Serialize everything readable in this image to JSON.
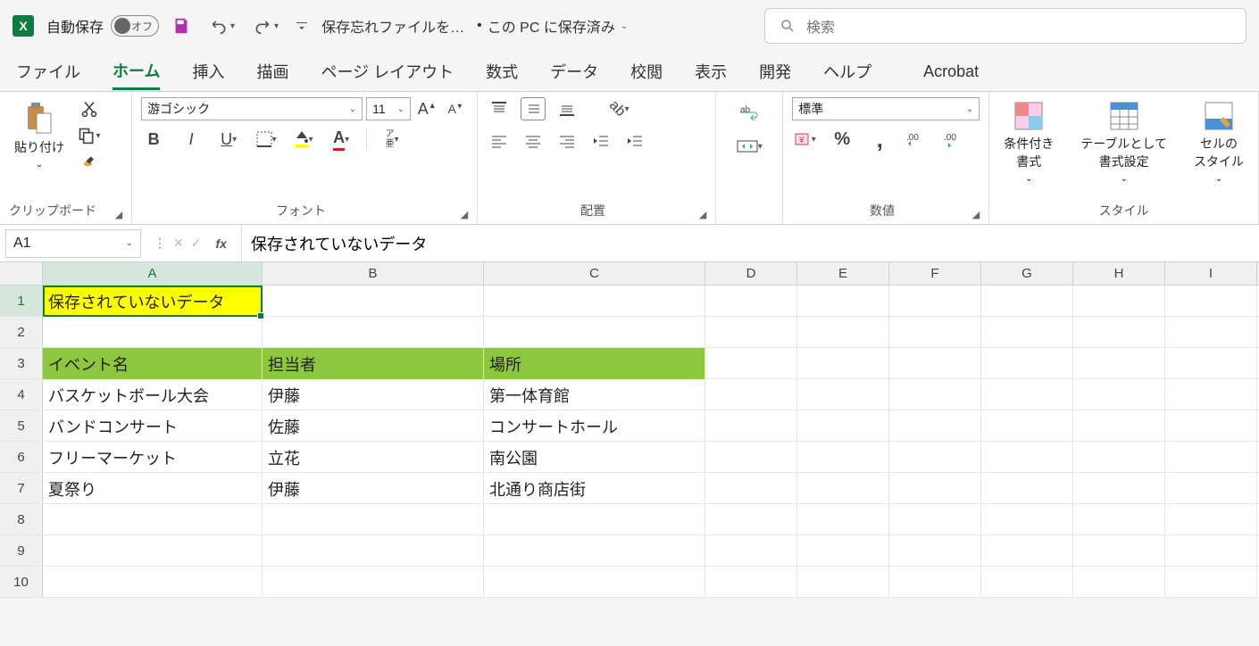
{
  "titlebar": {
    "autosave_label": "自動保存",
    "autosave_state": "オフ",
    "file_title": "保存忘れファイルを…",
    "location": "この PC に保存済み",
    "search_placeholder": "検索"
  },
  "tabs": [
    "ファイル",
    "ホーム",
    "挿入",
    "描画",
    "ページ レイアウト",
    "数式",
    "データ",
    "校閲",
    "表示",
    "開発",
    "ヘルプ",
    "Acrobat"
  ],
  "active_tab": "ホーム",
  "ribbon": {
    "clipboard": {
      "paste": "貼り付け",
      "label": "クリップボード"
    },
    "font": {
      "name": "游ゴシック",
      "size": "11",
      "label": "フォント",
      "ruby": "ア\n亜"
    },
    "alignment": {
      "label": "配置"
    },
    "number": {
      "format": "標準",
      "label": "数値"
    },
    "styles": {
      "cond": "条件付き\n書式",
      "table": "テーブルとして\n書式設定",
      "cell": "セルの\nスタイル",
      "label": "スタイル"
    }
  },
  "namebox": "A1",
  "formula": "保存されていないデータ",
  "columns": [
    "A",
    "B",
    "C",
    "D",
    "E",
    "F",
    "G",
    "H",
    "I"
  ],
  "rows": [
    "1",
    "2",
    "3",
    "4",
    "5",
    "6",
    "7",
    "8",
    "9",
    "10"
  ],
  "cells": {
    "A1": "保存されていないデータ",
    "A3": "イベント名",
    "B3": "担当者",
    "C3": "場所",
    "A4": "バスケットボール大会",
    "B4": "伊藤",
    "C4": "第一体育館",
    "A5": "バンドコンサート",
    "B5": "佐藤",
    "C5": "コンサートホール",
    "A6": "フリーマーケット",
    "B6": "立花",
    "C6": "南公園",
    "A7": "夏祭り",
    "B7": "伊藤",
    "C7": "北通り商店街"
  }
}
